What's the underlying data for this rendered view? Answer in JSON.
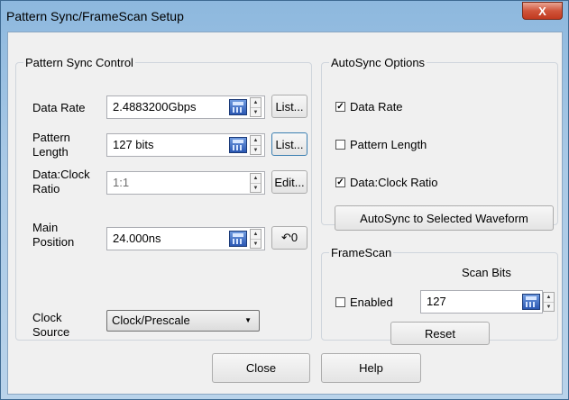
{
  "window": {
    "title": "Pattern Sync/FrameScan Setup",
    "close_glyph": "X"
  },
  "pattern_sync": {
    "legend": "Pattern Sync Control",
    "data_rate": {
      "label": "Data Rate",
      "value": "2.4883200Gbps",
      "button": "List..."
    },
    "pattern_length": {
      "label": "Pattern Length",
      "value": "127 bits",
      "button": "List..."
    },
    "data_clock": {
      "label": "Data:Clock Ratio",
      "value": "1:1",
      "button": "Edit..."
    },
    "main_position": {
      "label": "Main Position",
      "value": "24.000ns",
      "button": "↶0"
    },
    "clock_source": {
      "label": "Clock Source",
      "value": "Clock/Prescale"
    }
  },
  "autosync": {
    "legend": "AutoSync Options",
    "options": [
      {
        "label": "Data Rate",
        "checked": true
      },
      {
        "label": "Pattern Length",
        "checked": false
      },
      {
        "label": "Data:Clock Ratio",
        "checked": true
      }
    ],
    "button": "AutoSync to Selected Waveform"
  },
  "framescan": {
    "legend": "FrameScan",
    "scan_bits_label": "Scan Bits",
    "enabled_label": "Enabled",
    "enabled_checked": false,
    "scan_bits_value": "127",
    "reset": "Reset"
  },
  "footer": {
    "close": "Close",
    "help": "Help"
  },
  "colors": {
    "title_bar": "#8db8de",
    "close_button": "#c1391f",
    "dialog_bg": "#f0f0f0"
  }
}
